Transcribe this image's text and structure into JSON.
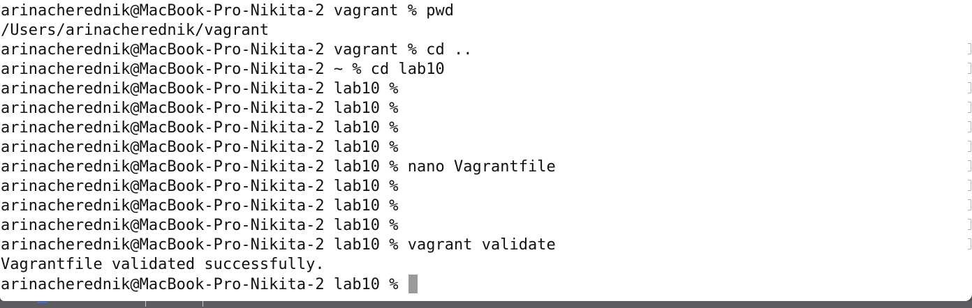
{
  "terminal": {
    "prompt": "arinacherednik@MacBook-Pro-Nikita-2",
    "lines": [
      "arinacherednik@MacBook-Pro-Nikita-2 vagrant % pwd",
      "/Users/arinacherednik/vagrant",
      "arinacherednik@MacBook-Pro-Nikita-2 vagrant % cd ..",
      "arinacherednik@MacBook-Pro-Nikita-2 ~ % cd lab10",
      "arinacherednik@MacBook-Pro-Nikita-2 lab10 %",
      "arinacherednik@MacBook-Pro-Nikita-2 lab10 %",
      "arinacherednik@MacBook-Pro-Nikita-2 lab10 %",
      "arinacherednik@MacBook-Pro-Nikita-2 lab10 %",
      "arinacherednik@MacBook-Pro-Nikita-2 lab10 % nano Vagrantfile",
      "arinacherednik@MacBook-Pro-Nikita-2 lab10 %",
      "arinacherednik@MacBook-Pro-Nikita-2 lab10 %",
      "arinacherednik@MacBook-Pro-Nikita-2 lab10 %",
      "arinacherednik@MacBook-Pro-Nikita-2 lab10 % vagrant validate",
      "Vagrantfile validated successfully."
    ],
    "current_prompt": "arinacherednik@MacBook-Pro-Nikita-2 lab10 % ",
    "colors": {
      "background": "#ffffff",
      "text": "#111111",
      "cursor": "#9a9a9a"
    }
  }
}
